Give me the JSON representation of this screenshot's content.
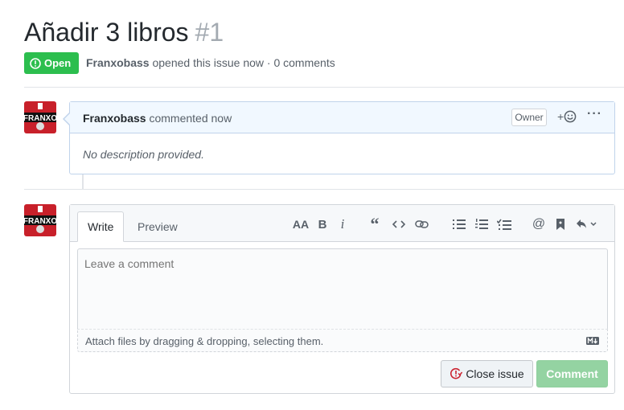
{
  "issue": {
    "title": "Añadir 3 libros",
    "number": "#1",
    "status": "Open",
    "author": "Franxobass",
    "meta_rest": "opened this issue now · 0 comments"
  },
  "comment": {
    "author": "Franxobass",
    "action": "commented now",
    "role": "Owner",
    "reaction_label": "+",
    "more": "···",
    "body": "No description provided."
  },
  "editor": {
    "tabs": [
      "Write",
      "Preview"
    ],
    "placeholder": "Leave a comment",
    "attach_text": "Attach files by dragging & dropping, selecting them.",
    "close_label": "Close issue",
    "comment_label": "Comment"
  },
  "avatar": {
    "text": "FRANXO"
  },
  "colors": {
    "open": "#2cbe4e",
    "close_icon": "#cb2431",
    "comment_btn": "#94d3a2"
  }
}
